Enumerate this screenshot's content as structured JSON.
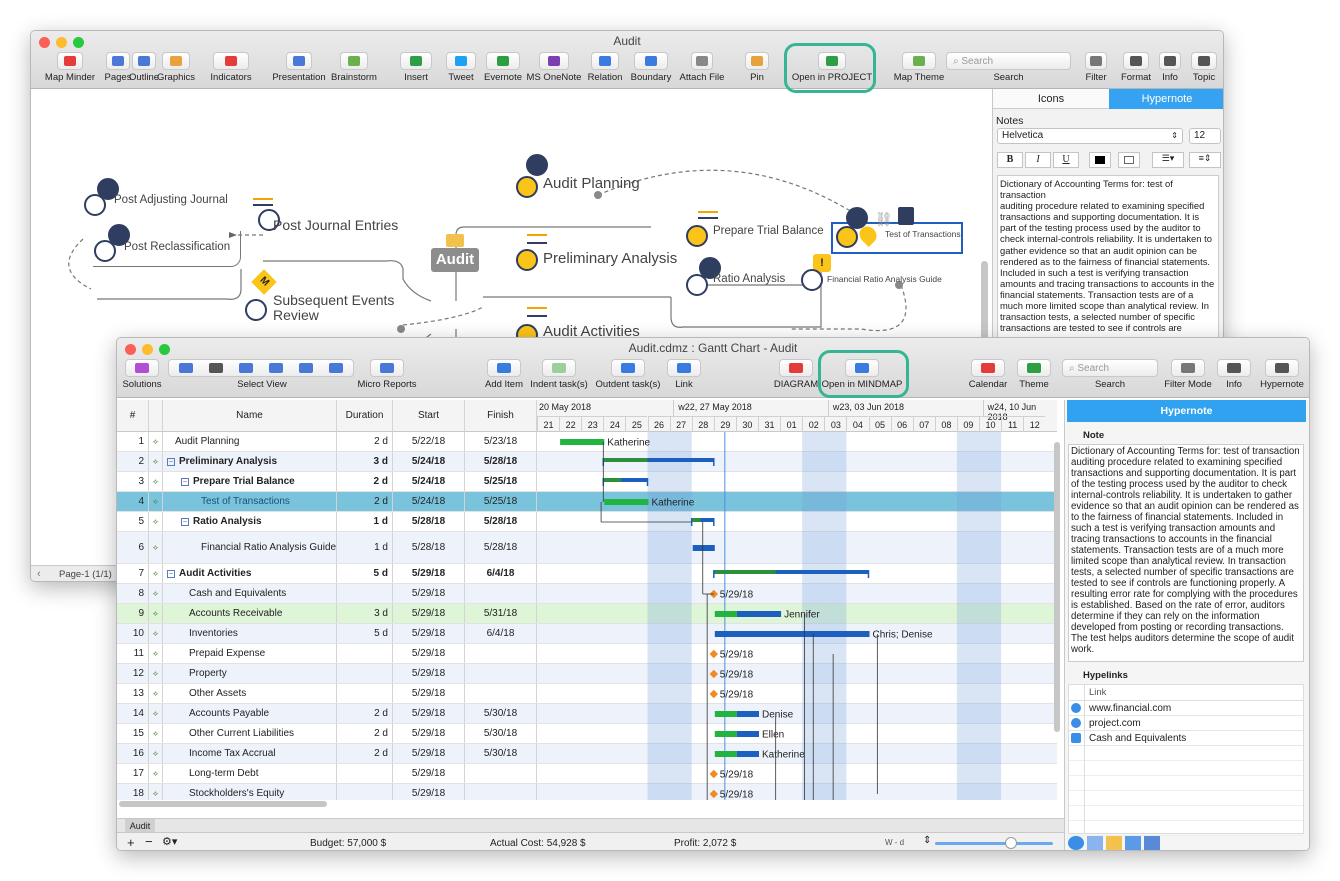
{
  "mindmap": {
    "title": "Audit",
    "toolbar": [
      {
        "id": "map-minder",
        "label": "Map Minder"
      },
      {
        "id": "pages",
        "label": "Pages"
      },
      {
        "id": "outline",
        "label": "Outline"
      },
      {
        "id": "graphics",
        "label": "Graphics"
      },
      {
        "id": "indicators",
        "label": "Indicators"
      },
      {
        "id": "presentation",
        "label": "Presentation"
      },
      {
        "id": "brainstorm",
        "label": "Brainstorm"
      },
      {
        "id": "insert",
        "label": "Insert"
      },
      {
        "id": "tweet",
        "label": "Tweet"
      },
      {
        "id": "evernote",
        "label": "Evernote"
      },
      {
        "id": "ms-onenote",
        "label": "MS OneNote"
      },
      {
        "id": "relation",
        "label": "Relation"
      },
      {
        "id": "boundary",
        "label": "Boundary"
      },
      {
        "id": "attach-file",
        "label": "Attach File"
      },
      {
        "id": "pin",
        "label": "Pin"
      },
      {
        "id": "open-in-project",
        "label": "Open in PROJECT"
      },
      {
        "id": "map-theme",
        "label": "Map Theme"
      },
      {
        "id": "search",
        "label": "Search"
      },
      {
        "id": "filter",
        "label": "Filter"
      },
      {
        "id": "format",
        "label": "Format"
      },
      {
        "id": "info",
        "label": "Info"
      },
      {
        "id": "topic",
        "label": "Topic"
      }
    ],
    "search_placeholder": "Search",
    "panel_tabs": [
      "Icons",
      "Hypernote"
    ],
    "notes_label": "Notes",
    "font_name": "Helvetica",
    "font_size": "12",
    "format_buttons": [
      "B",
      "I",
      "U"
    ],
    "notes_text": "Dictionary of Accounting Terms for: test of transaction\nauditing procedure related to examining specified transactions and supporting documentation. It is part of the testing process used by the auditor to check internal-controls reliability. It is undertaken to gather evidence so that an audit opinion can be rendered as to the fairness of financial statements. Included in such a test is verifying transaction amounts and tracing transactions to accounts in the financial statements. Transaction tests are of a much more limited scope than analytical review. In transaction tests, a selected number of specific transactions are tested to see if controls are",
    "page_label": "Page-1 (1/1)",
    "nodes": {
      "center": "Audit",
      "audit_planning": "Audit Planning",
      "preliminary_analysis": "Preliminary Analysis",
      "audit_activities": "Audit Activities",
      "post_adjusting": "Post Adjusting Journal",
      "post_journal": "Post Journal Entries",
      "post_reclass": "Post Reclassification",
      "subsequent_l1": "Subsequent Events",
      "subsequent_l2": "Review",
      "prepare_trial": "Prepare Trial Balance",
      "test_transactions": "Test of Transactions",
      "ratio_analysis": "Ratio Analysis",
      "financial_ratio": "Financial Ratio Analysis Guide",
      "m_badge": "M"
    }
  },
  "gantt": {
    "title": "Audit.cdmz : Gantt Chart - Audit",
    "toolbar": [
      {
        "id": "solutions",
        "label": "Solutions"
      },
      {
        "id": "select-view",
        "label": "Select View"
      },
      {
        "id": "micro-reports",
        "label": "Micro Reports"
      },
      {
        "id": "add-item",
        "label": "Add Item"
      },
      {
        "id": "indent",
        "label": "Indent task(s)"
      },
      {
        "id": "outdent",
        "label": "Outdent task(s)"
      },
      {
        "id": "link",
        "label": "Link"
      },
      {
        "id": "diagram",
        "label": "DIAGRAM"
      },
      {
        "id": "open-in-mindmap",
        "label": "Open in MINDMAP"
      },
      {
        "id": "calendar",
        "label": "Calendar"
      },
      {
        "id": "theme",
        "label": "Theme"
      },
      {
        "id": "search",
        "label": "Search"
      },
      {
        "id": "filter-mode",
        "label": "Filter Mode"
      },
      {
        "id": "info",
        "label": "Info"
      },
      {
        "id": "hypernote",
        "label": "Hypernote"
      }
    ],
    "search_placeholder": "Search",
    "columns": [
      "#",
      "Name",
      "Duration",
      "Start",
      "Finish"
    ],
    "weeks": [
      "20 May 2018",
      "w22, 27 May 2018",
      "w23, 03 Jun 2018",
      "w24, 10 Jun 2018"
    ],
    "days": [
      "21",
      "22",
      "23",
      "24",
      "25",
      "26",
      "27",
      "28",
      "29",
      "30",
      "31",
      "01",
      "02",
      "03",
      "04",
      "05",
      "06",
      "07",
      "08",
      "09",
      "10",
      "11",
      "12"
    ],
    "rows": [
      {
        "n": "1",
        "name": "Audit Planning",
        "dur": "2 d",
        "start": "5/22/18",
        "finish": "5/23/18",
        "lvl": 0,
        "bold": false
      },
      {
        "n": "2",
        "name": "Preliminary Analysis",
        "dur": "3 d",
        "start": "5/24/18",
        "finish": "5/28/18",
        "lvl": 0,
        "bold": true
      },
      {
        "n": "3",
        "name": "Prepare Trial Balance",
        "dur": "2 d",
        "start": "5/24/18",
        "finish": "5/25/18",
        "lvl": 1,
        "bold": true
      },
      {
        "n": "4",
        "name": "Test of Transactions",
        "dur": "2 d",
        "start": "5/24/18",
        "finish": "5/25/18",
        "lvl": 2,
        "bold": false
      },
      {
        "n": "5",
        "name": "Ratio Analysis",
        "dur": "1 d",
        "start": "5/28/18",
        "finish": "5/28/18",
        "lvl": 1,
        "bold": true
      },
      {
        "n": "6",
        "name": "Financial Ratio Analysis Guide",
        "dur": "1 d",
        "start": "5/28/18",
        "finish": "5/28/18",
        "lvl": 2,
        "bold": false
      },
      {
        "n": "7",
        "name": "Audit Activities",
        "dur": "5 d",
        "start": "5/29/18",
        "finish": "6/4/18",
        "lvl": 0,
        "bold": true
      },
      {
        "n": "8",
        "name": "Cash and Equivalents",
        "dur": "",
        "start": "5/29/18",
        "finish": "",
        "lvl": 1,
        "bold": false
      },
      {
        "n": "9",
        "name": "Accounts Receivable",
        "dur": "3 d",
        "start": "5/29/18",
        "finish": "5/31/18",
        "lvl": 1,
        "bold": false
      },
      {
        "n": "10",
        "name": "Inventories",
        "dur": "5 d",
        "start": "5/29/18",
        "finish": "6/4/18",
        "lvl": 1,
        "bold": false
      },
      {
        "n": "11",
        "name": "Prepaid Expense",
        "dur": "",
        "start": "5/29/18",
        "finish": "",
        "lvl": 1,
        "bold": false
      },
      {
        "n": "12",
        "name": "Property",
        "dur": "",
        "start": "5/29/18",
        "finish": "",
        "lvl": 1,
        "bold": false
      },
      {
        "n": "13",
        "name": "Other Assets",
        "dur": "",
        "start": "5/29/18",
        "finish": "",
        "lvl": 1,
        "bold": false
      },
      {
        "n": "14",
        "name": "Accounts Payable",
        "dur": "2 d",
        "start": "5/29/18",
        "finish": "5/30/18",
        "lvl": 1,
        "bold": false
      },
      {
        "n": "15",
        "name": "Other Current Liabilities",
        "dur": "2 d",
        "start": "5/29/18",
        "finish": "5/30/18",
        "lvl": 1,
        "bold": false
      },
      {
        "n": "16",
        "name": "Income Tax  Accrual",
        "dur": "2 d",
        "start": "5/29/18",
        "finish": "5/30/18",
        "lvl": 1,
        "bold": false
      },
      {
        "n": "17",
        "name": "Long-term Debt",
        "dur": "",
        "start": "5/29/18",
        "finish": "",
        "lvl": 1,
        "bold": false
      },
      {
        "n": "18",
        "name": "Stockholders's Equity",
        "dur": "",
        "start": "5/29/18",
        "finish": "",
        "lvl": 1,
        "bold": false
      }
    ],
    "bar_labels": {
      "r1": "Katherine",
      "r4": "Katherine",
      "r9": "Jennifer",
      "r10": "Chris; Denise",
      "r14": "Denise",
      "r15": "Ellen",
      "r16": "Katherine",
      "milestone": "5/29/18"
    },
    "hypernote": {
      "title": "Hypernote",
      "note_label": "Note",
      "note": "Dictionary of Accounting Terms for: test of transaction auditing procedure related to examining specified transactions and supporting documentation. It is part of the testing process used by the auditor to check internal-controls reliability. It is undertaken to gather evidence so that an audit opinion can be rendered as to the fairness of financial statements. Included in such a test is verifying transaction amounts and tracing transactions to accounts in the financial statements. Transaction tests are of a much more limited scope than analytical review. In transaction tests, a selected number of specific transactions are tested to see if controls are functioning properly. A resulting error rate for complying with the procedures is established. Based on the rate of error, auditors determine if they can rely on the information developed from posting or recording transactions. The test helps auditors determine the scope of audit work.",
      "links_label": "Hypelinks",
      "link_col": "Link",
      "links": [
        "www.financial.com",
        "project.com",
        "Cash and Equivalents"
      ]
    },
    "sheet_tab": "Audit",
    "status": {
      "budget": "Budget: 57,000 $",
      "actual": "Actual Cost: 54,928 $",
      "profit": "Profit: 2,072 $",
      "zoom": "W - d"
    }
  }
}
